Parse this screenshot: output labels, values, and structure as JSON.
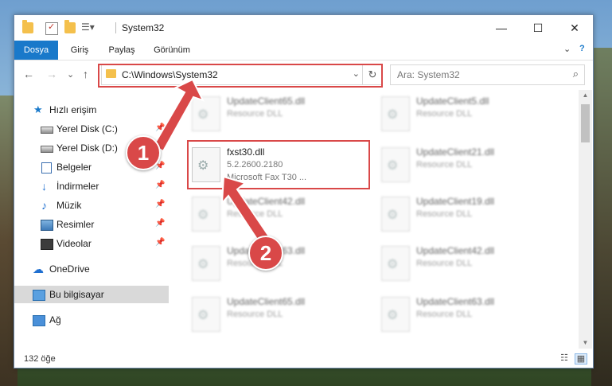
{
  "window": {
    "title": "System32",
    "minimize": "—",
    "maximize": "☐",
    "close": "✕"
  },
  "ribbon": {
    "tabs": [
      "Dosya",
      "Giriş",
      "Paylaş",
      "Görünüm"
    ],
    "collapse": "⌄",
    "help": "?"
  },
  "address": {
    "path": "C:\\Windows\\System32",
    "dropdown": "⌄",
    "refresh": "↻"
  },
  "nav_buttons": {
    "back": "←",
    "forward": "→",
    "recent": "⌄",
    "up": "↑"
  },
  "search": {
    "placeholder": "Ara: System32",
    "icon": "⌕"
  },
  "sidebar": {
    "items": [
      {
        "label": "Hızlı erişim",
        "icon": "star-icon",
        "pinned": false
      },
      {
        "label": "Yerel Disk (C:)",
        "icon": "drive-icon",
        "pinned": true
      },
      {
        "label": "Yerel Disk (D:)",
        "icon": "drive-icon",
        "pinned": true
      },
      {
        "label": "Belgeler",
        "icon": "documents-icon",
        "pinned": true
      },
      {
        "label": "İndirmeler",
        "icon": "downloads-icon",
        "pinned": true
      },
      {
        "label": "Müzik",
        "icon": "music-icon",
        "pinned": true
      },
      {
        "label": "Resimler",
        "icon": "pictures-icon",
        "pinned": true
      },
      {
        "label": "Videolar",
        "icon": "videos-icon",
        "pinned": true
      },
      {
        "label": "OneDrive",
        "icon": "onedrive-icon",
        "pinned": false
      },
      {
        "label": "Bu bilgisayar",
        "icon": "this-pc-icon",
        "pinned": false,
        "selected": true
      },
      {
        "label": "Ağ",
        "icon": "network-icon",
        "pinned": false
      }
    ]
  },
  "files": [
    {
      "name": "UpdateClient65.dll",
      "sub": "Resource DLL"
    },
    {
      "name": "UpdateClient5.dll",
      "sub": "Resource DLL"
    },
    {
      "name": "fxst30.dll",
      "version": "5.2.2600.2180",
      "desc": "Microsoft  Fax T30 ..."
    },
    {
      "name": "UpdateClient21.dll",
      "sub": "Resource DLL"
    },
    {
      "name": "UpdateClient42.dll",
      "sub": "Resource DLL"
    },
    {
      "name": "UpdateClient19.dll",
      "sub": "Resource DLL"
    },
    {
      "name": "UpdateClient63.dll",
      "sub": "Resource DLL"
    },
    {
      "name": "UpdateClient42.dll",
      "sub": "Resource DLL"
    },
    {
      "name": "UpdateClient65.dll",
      "sub": "Resource DLL"
    },
    {
      "name": "UpdateClient63.dll",
      "sub": "Resource DLL"
    }
  ],
  "status": {
    "count": "132 öğe"
  },
  "annotations": {
    "step1": "1",
    "step2": "2"
  },
  "colors": {
    "accent": "#1979ca",
    "annotation": "#d94848"
  }
}
